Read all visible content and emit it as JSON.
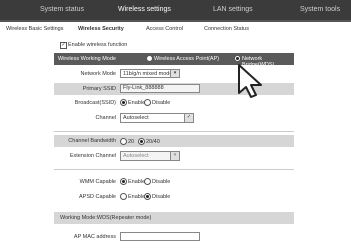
{
  "topnav": [
    "System status",
    "Wireless settings",
    "LAN settings",
    "System tools"
  ],
  "subnav": [
    "Wireless Basic Settings",
    "Wireless Security",
    "Access Control",
    "Connection Status"
  ],
  "enable_wireless_label": "Enable wireless function",
  "working_mode": {
    "label": "Wireless Working Mode",
    "options": [
      "Wireless Access Point(AP)",
      "Network Bridge(WDS)"
    ],
    "selected": "Network Bridge(WDS)"
  },
  "network_mode": {
    "label": "Network Mode",
    "value": "11b/g/n mixed mode"
  },
  "primary_ssid": {
    "label": "Primary SSID",
    "value": "Fly-Link_888888"
  },
  "broadcast": {
    "label": "Broadcast(SSID)",
    "options": [
      "Enable",
      "Disable"
    ],
    "selected": "Enable"
  },
  "channel": {
    "label": "Channel",
    "value": "Autoselect"
  },
  "channel_bandwidth": {
    "label": "Channel Bandwidth",
    "options": [
      "20",
      "20/40"
    ],
    "selected": "20/40"
  },
  "extension_channel": {
    "label": "Extension Channel",
    "value": "Autoselect"
  },
  "wmm": {
    "label": "WMM Capable",
    "options": [
      "Enable",
      "Disable"
    ],
    "selected": "Enable"
  },
  "apsd": {
    "label": "APSD Capable",
    "options": [
      "Enable",
      "Disable"
    ],
    "selected": "Disable"
  },
  "wds_section_title": "Working Mode:WDS(Repeater mode)",
  "ap_mac": {
    "label": "AP MAC address",
    "value": ""
  },
  "icons": {
    "dropdown": "chevron-down-icon",
    "cursor": "mouse-cursor-icon"
  }
}
